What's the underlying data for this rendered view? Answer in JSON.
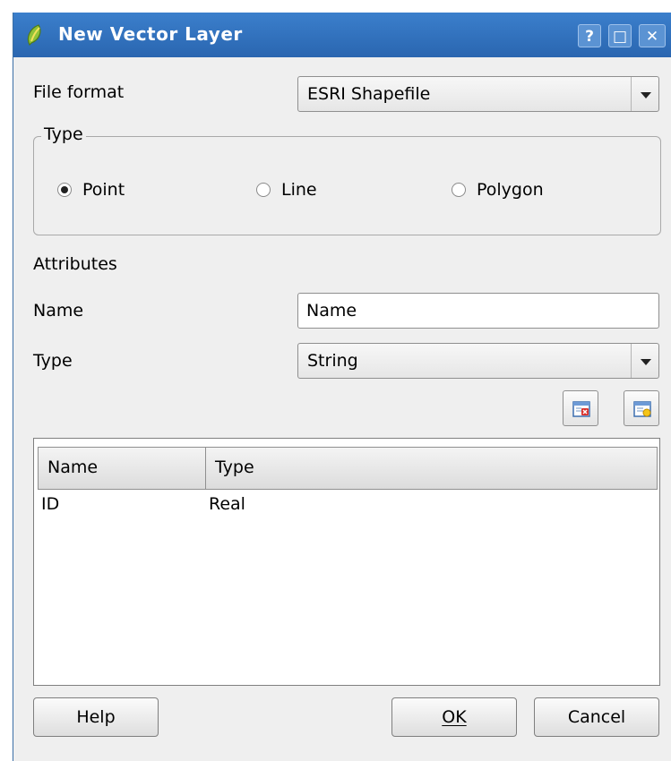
{
  "window": {
    "title": "New Vector Layer",
    "title_buttons": {
      "help": "?",
      "maximize": "□",
      "close": "✕"
    }
  },
  "file_format": {
    "label": "File format",
    "value": "ESRI Shapefile"
  },
  "geometry_type": {
    "group_title": "Type",
    "options": [
      "Point",
      "Line",
      "Polygon"
    ],
    "selected": "Point"
  },
  "attributes": {
    "section_label": "Attributes",
    "name_label": "Name",
    "name_value": "Name",
    "type_label": "Type",
    "type_value": "String",
    "delete_icon": "delete-attribute-icon",
    "add_icon": "add-attribute-icon"
  },
  "table": {
    "columns": [
      "Name",
      "Type"
    ],
    "rows": [
      {
        "name": "ID",
        "type": "Real"
      }
    ]
  },
  "buttons": {
    "help": "Help",
    "ok": "OK",
    "cancel": "Cancel"
  },
  "colors": {
    "titlebar": "#2f6fbf",
    "window_bg": "#efefef"
  }
}
